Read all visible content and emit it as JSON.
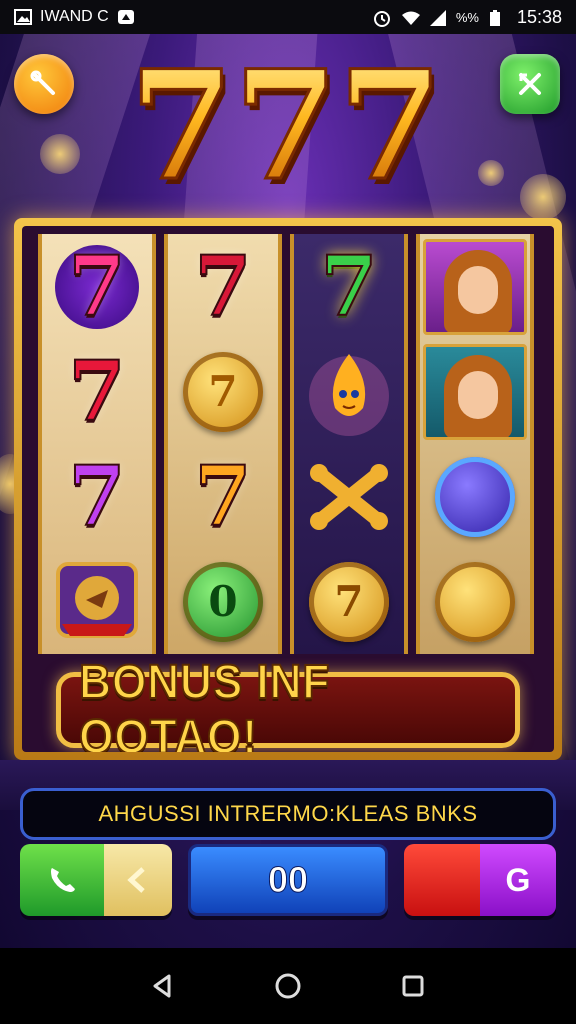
{
  "status_bar": {
    "left_text": "IWAND C",
    "time": "15:38",
    "network_label": "%%"
  },
  "game": {
    "logo_text": "777",
    "reels": [
      [
        "7",
        "7",
        "7",
        "emblem"
      ],
      [
        "7",
        "7-coin",
        "7",
        "0"
      ],
      [
        "7",
        "flame-face",
        "bone",
        "7-coin"
      ],
      [
        "portrait",
        "portrait",
        "orb",
        "coin"
      ]
    ],
    "bonus_banner": "BONUS INF QOTAO!",
    "ticker_text": "AHGUSSI INTRERMO:KLEAS BNKS",
    "bet_display": "00",
    "right_button_label": "G"
  },
  "colors": {
    "gold": "#f0be44",
    "purple_bg": "#3b1a7a",
    "green_button": "#1f9a2a",
    "blue_button": "#1042b8",
    "red_button": "#c81010",
    "magenta_button": "#8a10c8"
  },
  "nav": {
    "back_icon": "back-triangle-icon",
    "home_icon": "home-circle-icon",
    "recents_icon": "recents-square-icon"
  }
}
